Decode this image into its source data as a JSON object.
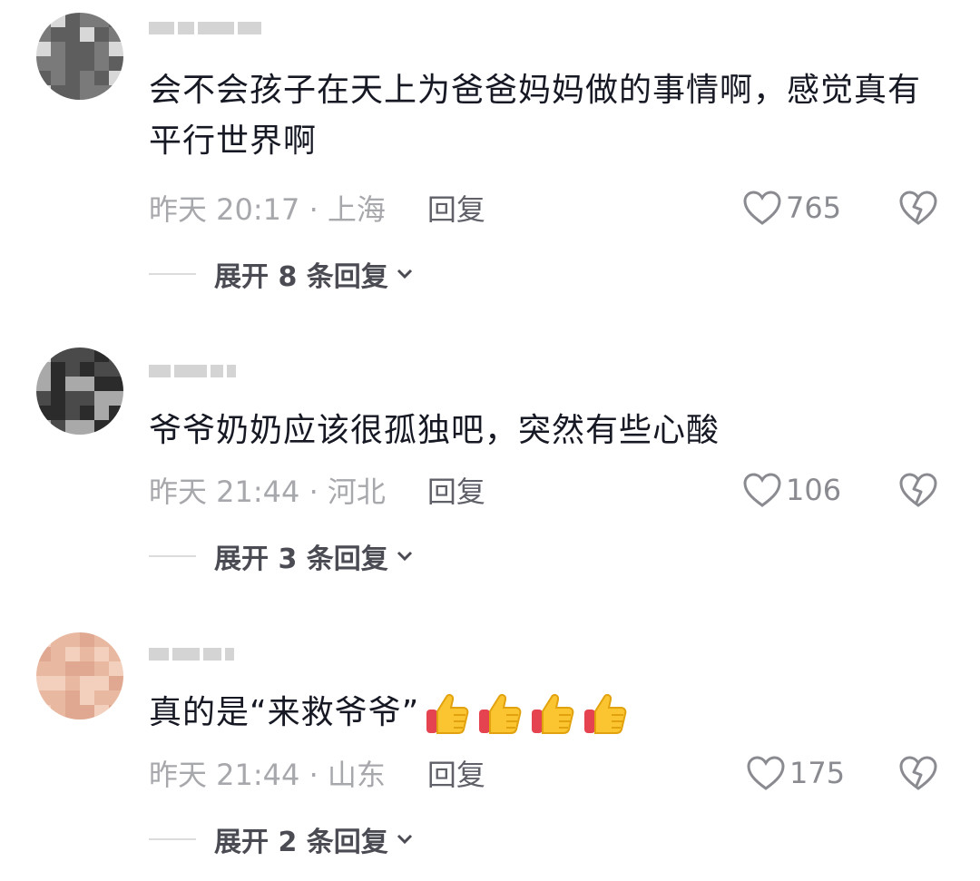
{
  "comments": [
    {
      "text": "会不会孩子在天上为爸爸妈妈做的事情啊，感觉真有平行世界啊",
      "time": "昨天 20:17 · 上海",
      "reply_label": "回复",
      "likes": "765",
      "expand_label": "展开 8 条回复",
      "avatar_palette": [
        "#d8d8d8",
        "#9a9a9a",
        "#5e5e5e",
        "#bdbdbd",
        "#7a7a7a",
        "#efefef"
      ]
    },
    {
      "text": "爷爷奶奶应该很孤独吧，突然有些心酸",
      "time": "昨天 21:44 · 河北",
      "reply_label": "回复",
      "likes": "106",
      "expand_label": "展开 3 条回复",
      "avatar_palette": [
        "#2b2b2b",
        "#6e6e6e",
        "#a9a9a9",
        "#e6e6e6",
        "#4a4a4a",
        "#cfcfcf"
      ]
    },
    {
      "text": "真的是“来救爷爷”",
      "time": "昨天 21:44 · 山东",
      "reply_label": "回复",
      "likes": "175",
      "expand_label": "展开 2 条回复",
      "emoji": "thumbs-up-icon",
      "emoji_count": 4,
      "avatar_palette": [
        "#e9b8a0",
        "#d69a80",
        "#f2d0bd",
        "#c58c74",
        "#e0a890",
        "#f5e0d4"
      ]
    }
  ],
  "colors": {
    "text": "#161823",
    "meta": "#a7a8ac",
    "expand": "#4a4b53",
    "like_stroke": "#8a8b90"
  }
}
